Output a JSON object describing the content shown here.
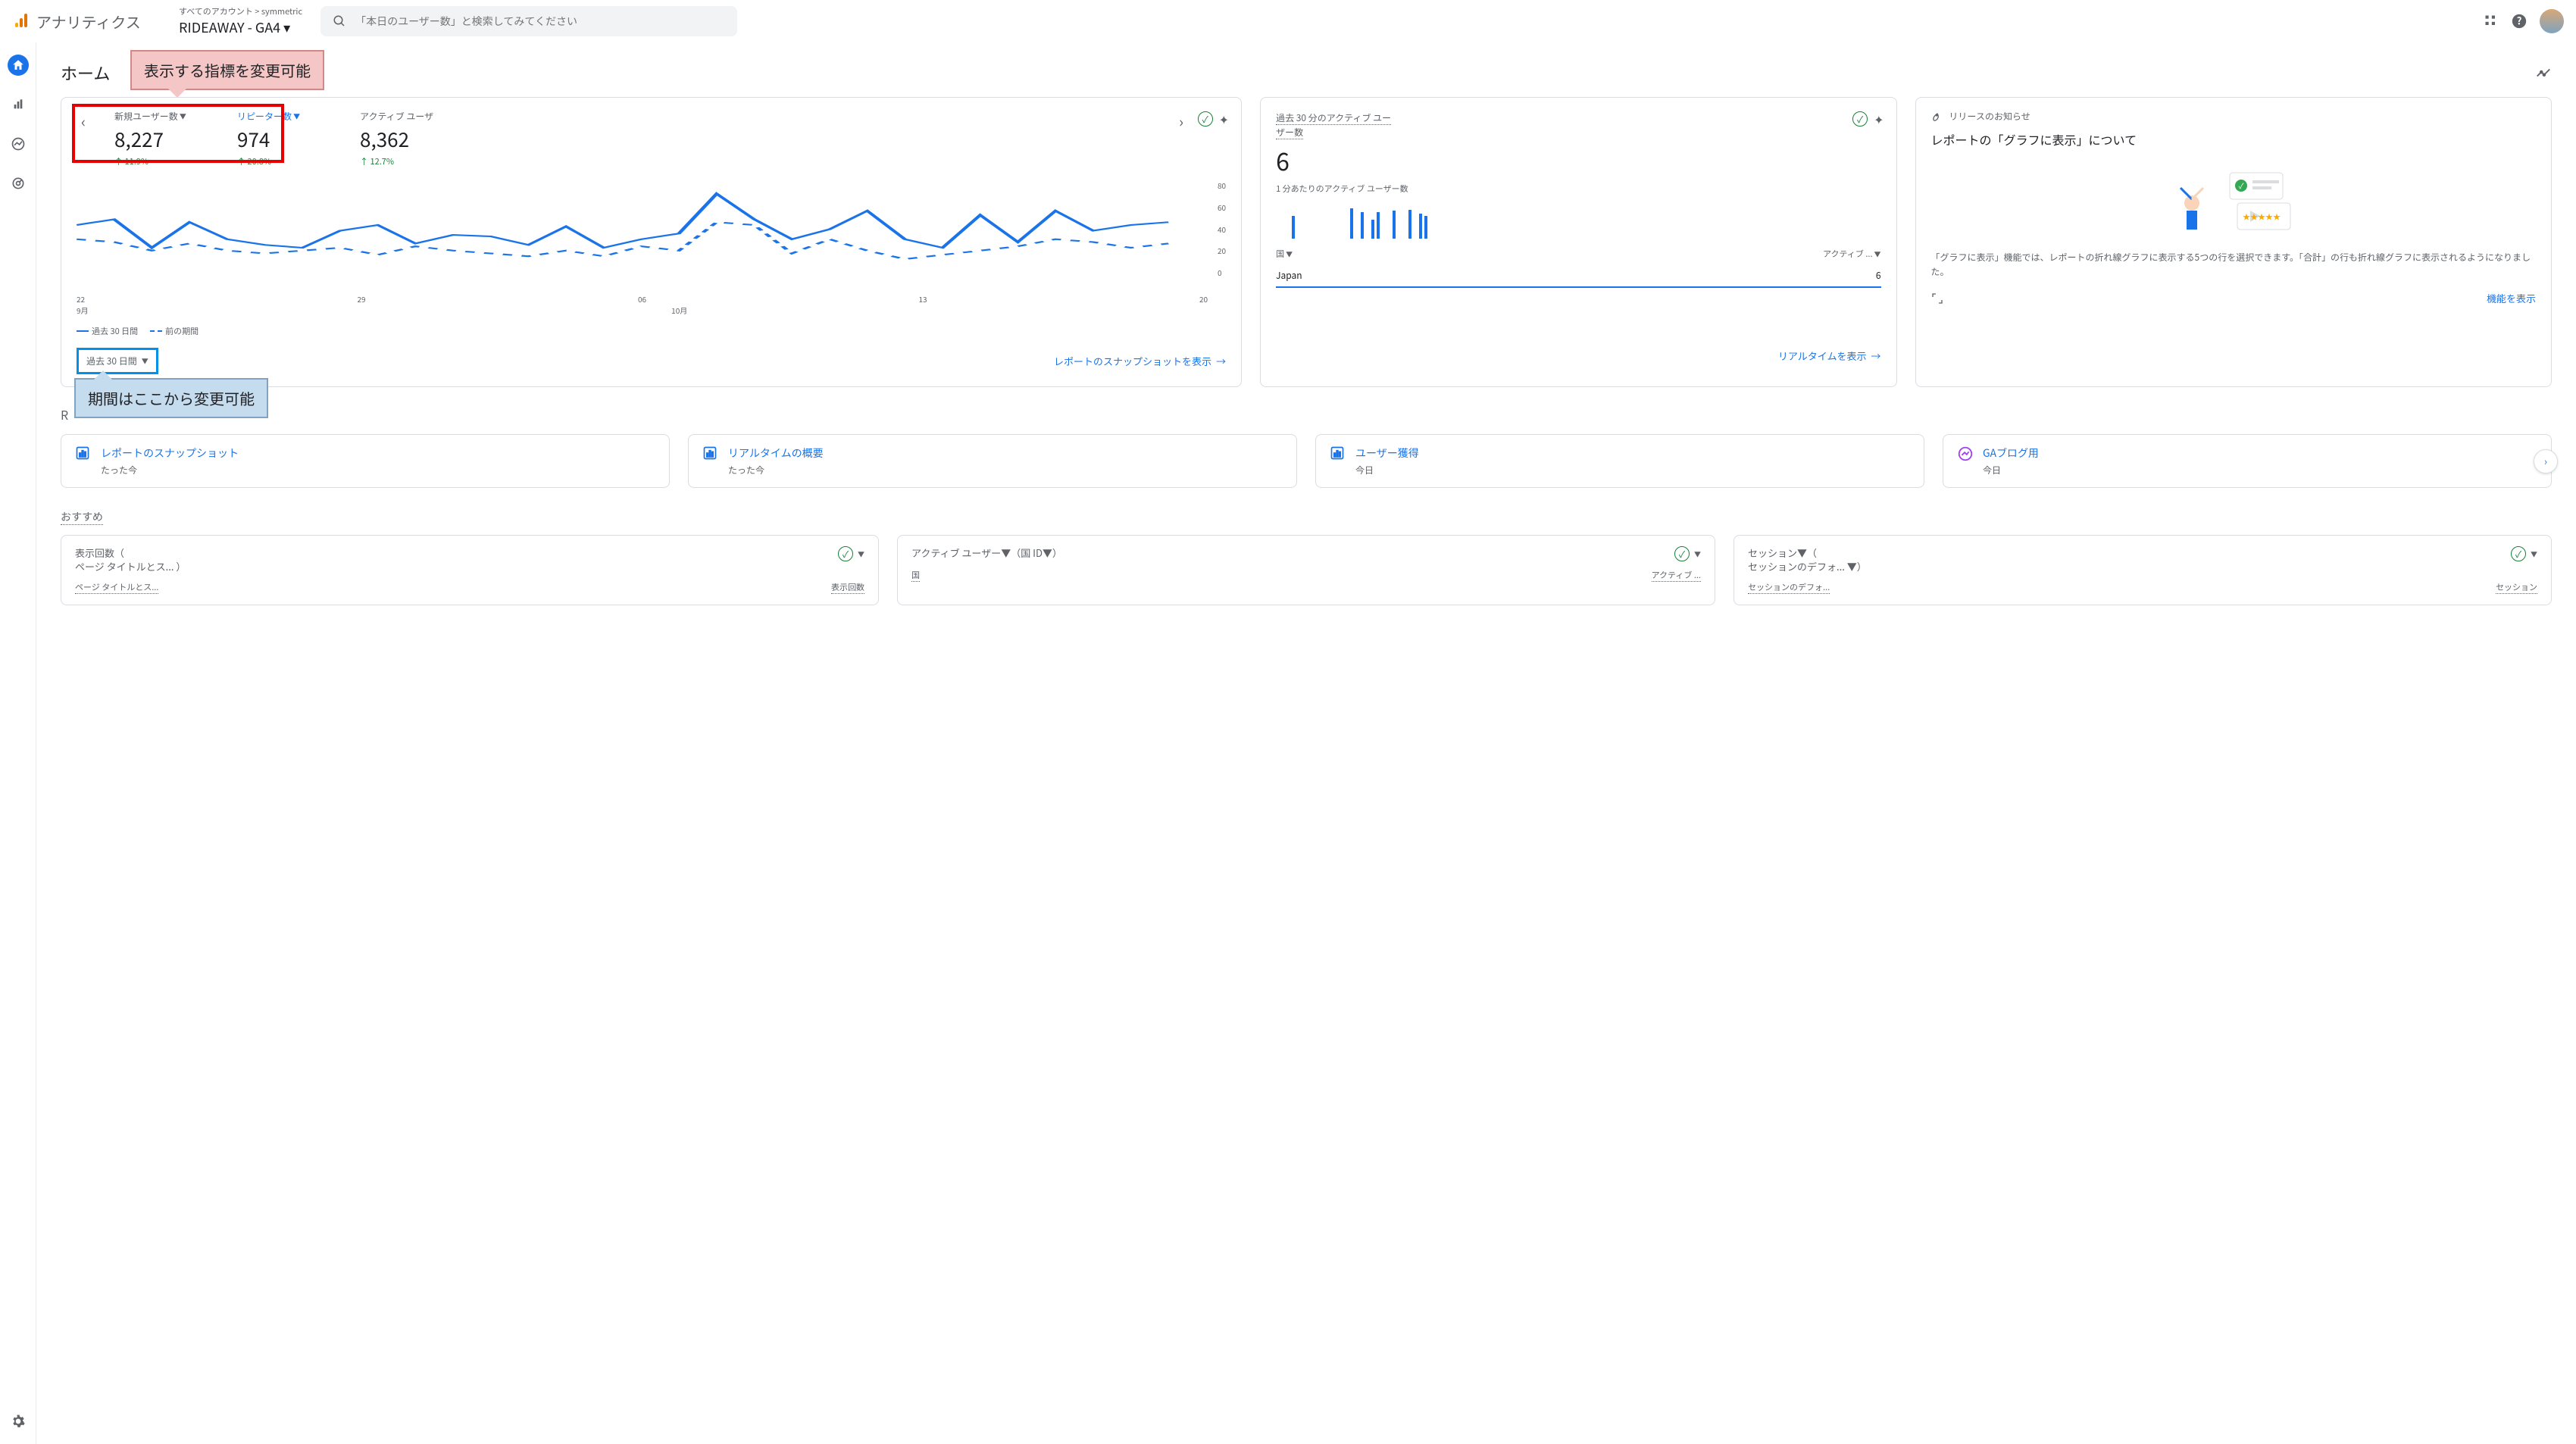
{
  "header": {
    "logo_text": "アナリティクス",
    "account_path_prefix": "すべてのアカウント >",
    "account_path_name": "symmetric",
    "account_current": "RIDEAWAY - GA4",
    "search_placeholder": "「本日のユーザー数」と検索してみてください"
  },
  "page": {
    "title": "ホーム",
    "callout_red": "表示する指標を変更可能",
    "callout_blue": "期間はここから変更可能",
    "section_recent_partial": "R",
    "section_suggest": "おすすめ"
  },
  "metrics": [
    {
      "label": "新規ユーザー数",
      "value": "8,227",
      "change": "↑ 11.9%",
      "blue": false
    },
    {
      "label": "リピーター数",
      "value": "974",
      "change": "↑ 20.8%",
      "blue": true
    },
    {
      "label": "アクティブ ユーザ",
      "value": "8,362",
      "change": "↑ 12.7%",
      "blue": false
    }
  ],
  "chart_data": {
    "type": "line",
    "x_labels": [
      "22",
      "29",
      "06",
      "13",
      "20"
    ],
    "x_month_left": "9月",
    "x_month_right": "10月",
    "ylim": [
      0,
      80
    ],
    "y_ticks": [
      "80",
      "60",
      "40",
      "20",
      "0"
    ],
    "series": [
      {
        "name": "過去 30 日間",
        "style": "solid",
        "values": [
          48,
          52,
          32,
          50,
          38,
          34,
          32,
          44,
          48,
          35,
          41,
          40,
          34,
          47,
          32,
          38,
          42,
          70,
          52,
          38,
          45,
          58,
          38,
          32,
          55,
          36,
          58,
          44,
          48,
          50
        ]
      },
      {
        "name": "前の期間",
        "style": "dashed",
        "values": [
          38,
          36,
          30,
          35,
          30,
          28,
          30,
          32,
          27,
          33,
          30,
          28,
          26,
          30,
          26,
          33,
          30,
          50,
          48,
          28,
          38,
          30,
          24,
          27,
          30,
          33,
          38,
          36,
          32,
          35
        ]
      }
    ],
    "legend": [
      "過去 30 日間",
      "前の期間"
    ]
  },
  "date_picker": "過去 30 日間",
  "main_card_link": "レポートのスナップショットを表示",
  "realtime": {
    "label": "過去 30 分のアクティブ ユーザー数",
    "value": "6",
    "sub": "1 分あたりのアクティブ ユーザー数",
    "bars": [
      0,
      0,
      0,
      30,
      0,
      0,
      0,
      0,
      0,
      0,
      0,
      0,
      0,
      0,
      40,
      0,
      35,
      0,
      25,
      35,
      0,
      0,
      37,
      0,
      0,
      38,
      0,
      33,
      30,
      0
    ],
    "col_left": "国",
    "col_right": "アクティブ ...",
    "row_country": "Japan",
    "row_value": "6",
    "link": "リアルタイムを表示"
  },
  "news": {
    "header_label": "リリースのお知らせ",
    "title": "レポートの「グラフに表示」について",
    "body": "「グラフに表示」機能では、レポートの折れ線グラフに表示する5つの行を選択できます。「合計」の行も折れ線グラフに表示されるようになりました。",
    "link": "機能を表示"
  },
  "quick_cards": [
    {
      "icon": "bar",
      "title": "レポートのスナップショット",
      "sub": "たった今"
    },
    {
      "icon": "bar",
      "title": "リアルタイムの概要",
      "sub": "たった今"
    },
    {
      "icon": "bar",
      "title": "ユーザー獲得",
      "sub": "今日"
    },
    {
      "icon": "explore",
      "title": "GAブログ用",
      "sub": "今日"
    }
  ],
  "bottom_cards": [
    {
      "title_line1": "表示回数（",
      "title_line2": "ページ タイトルとス...  ）",
      "col_left": "ページ タイトルとス...",
      "col_right": "表示回数"
    },
    {
      "title_line1": "アクティブ ユーザー▼（国 ID▼）",
      "title_line2": "",
      "col_left": "国",
      "col_right": "アクティブ ..."
    },
    {
      "title_line1": "セッション▼（",
      "title_line2": "セッションのデフォ... ▼）",
      "col_left": "セッションのデフォ...",
      "col_right": "セッション"
    }
  ]
}
